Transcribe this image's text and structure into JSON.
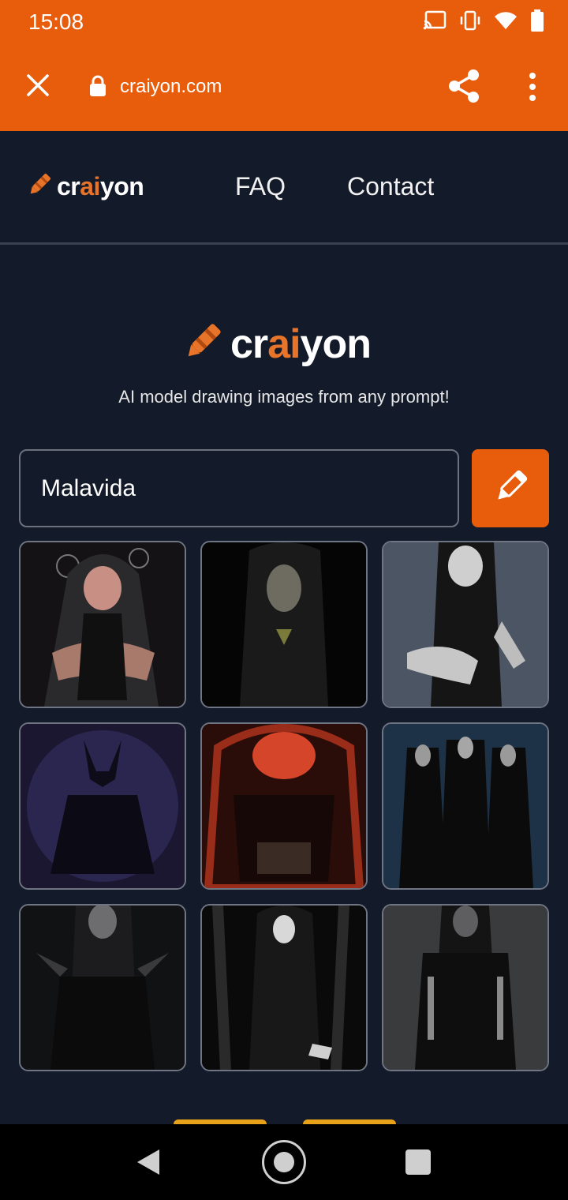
{
  "status_bar": {
    "time": "15:08",
    "icons": [
      "cast-icon",
      "vibrate-icon",
      "wifi-icon",
      "battery-icon"
    ]
  },
  "browser": {
    "url": "craiyon.com",
    "close_icon": "close-icon",
    "share_icon": "share-icon",
    "menu_icon": "more-vert-icon"
  },
  "site_nav": {
    "logo_pre": "cr",
    "logo_ai": "ai",
    "logo_post": "yon",
    "links": [
      {
        "label": "FAQ"
      },
      {
        "label": "Contact"
      }
    ]
  },
  "hero": {
    "logo_pre": "cr",
    "logo_ai": "ai",
    "logo_post": "yon",
    "tagline": "AI model drawing images from any prompt!"
  },
  "prompt": {
    "value": "Malavida",
    "button_icon": "pencil-icon"
  },
  "colors": {
    "brand": "#e85d0c",
    "accent_ai": "#e8742a",
    "background": "#131a29"
  },
  "results": [
    {
      "label": "generated-image-1"
    },
    {
      "label": "generated-image-2"
    },
    {
      "label": "generated-image-3"
    },
    {
      "label": "generated-image-4"
    },
    {
      "label": "generated-image-5"
    },
    {
      "label": "generated-image-6"
    },
    {
      "label": "generated-image-7"
    },
    {
      "label": "generated-image-8"
    },
    {
      "label": "generated-image-9"
    }
  ]
}
